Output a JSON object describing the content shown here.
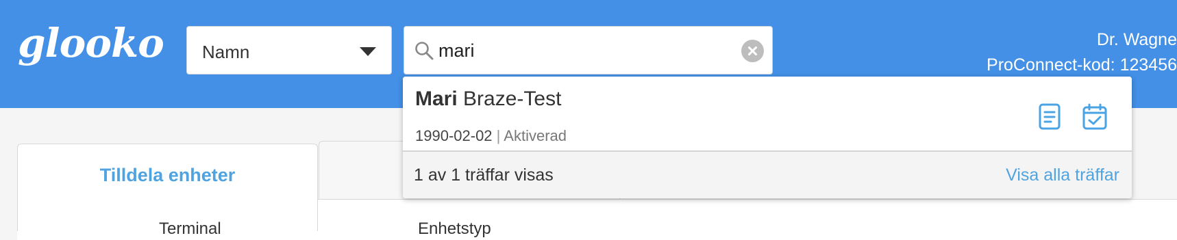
{
  "header": {
    "logo_text": "glooko",
    "search_type": {
      "selected": "Namn"
    },
    "search": {
      "value": "mari"
    },
    "user": {
      "name": "Dr. Wagne",
      "proconnect": "ProConnect-kod: 123456"
    }
  },
  "tabs": [
    {
      "label": "Tilldela enheter",
      "active": true
    },
    {
      "label": "",
      "active": false
    }
  ],
  "table": {
    "columns": [
      "Terminal",
      "Enhetstyp"
    ]
  },
  "dropdown": {
    "results": [
      {
        "first_name": "Mari",
        "last_name": "Braze-Test",
        "dob": "1990-02-02",
        "separator": "|",
        "status": "Aktiverad",
        "actions": [
          "summary-report-icon",
          "calendar-check-icon"
        ]
      }
    ],
    "footer": {
      "count_text": "1 av 1 träffar visas",
      "show_all_label": "Visa alla träffar"
    }
  },
  "colors": {
    "header_bg": "#4390e6",
    "accent": "#4fa3e0",
    "active_tab_text": "#4fa3e0"
  }
}
